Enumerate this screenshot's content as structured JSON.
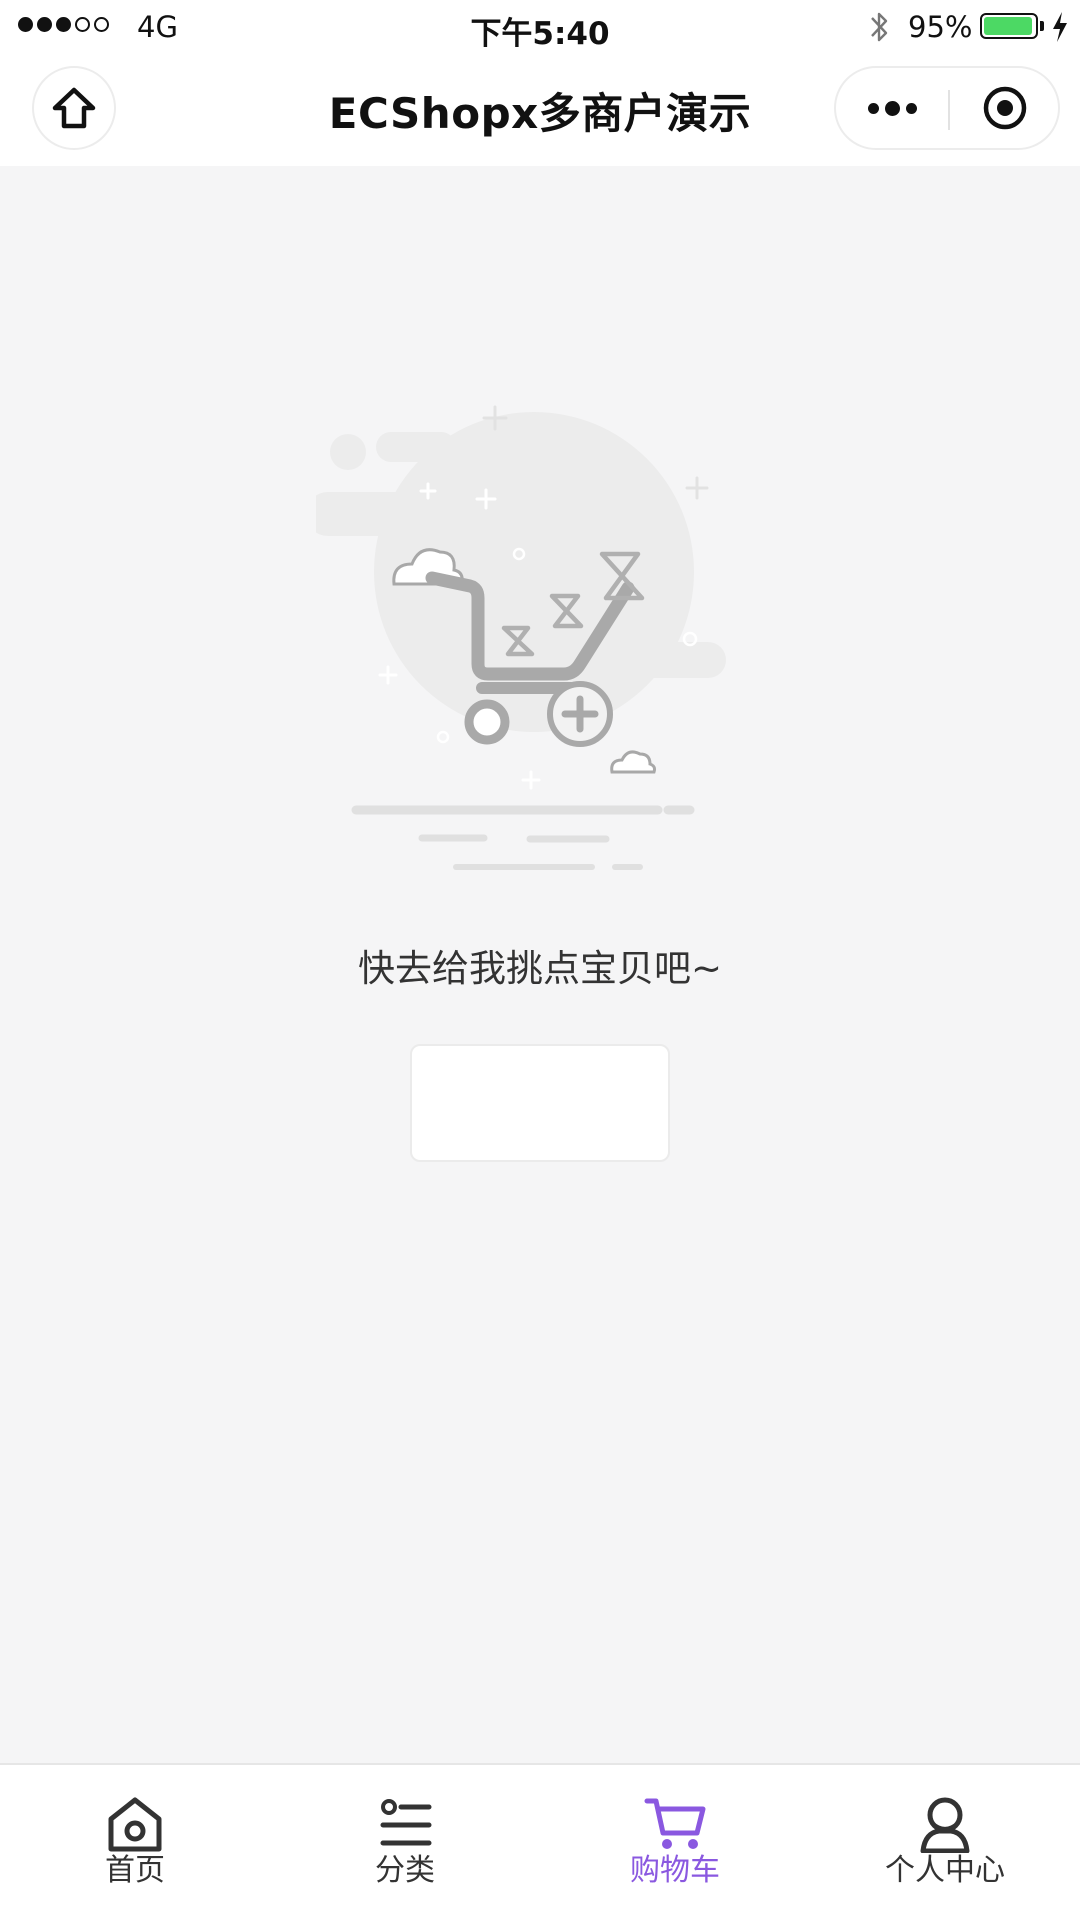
{
  "status_bar": {
    "carrier": "4G",
    "time": "下午5:40",
    "battery_percent": "95%",
    "battery_level": 0.95
  },
  "nav": {
    "title": "ECShopx多商户演示"
  },
  "empty_state": {
    "message": "快去给我挑点宝贝吧~"
  },
  "tabs": [
    {
      "label": "首页",
      "icon": "home-icon",
      "active": false
    },
    {
      "label": "分类",
      "icon": "category-list-icon",
      "active": false
    },
    {
      "label": "购物车",
      "icon": "cart-icon",
      "active": true
    },
    {
      "label": "个人中心",
      "icon": "user-icon",
      "active": false
    }
  ],
  "colors": {
    "accent": "#8a58e0",
    "background": "#f5f5f6",
    "battery": "#4cd964"
  }
}
